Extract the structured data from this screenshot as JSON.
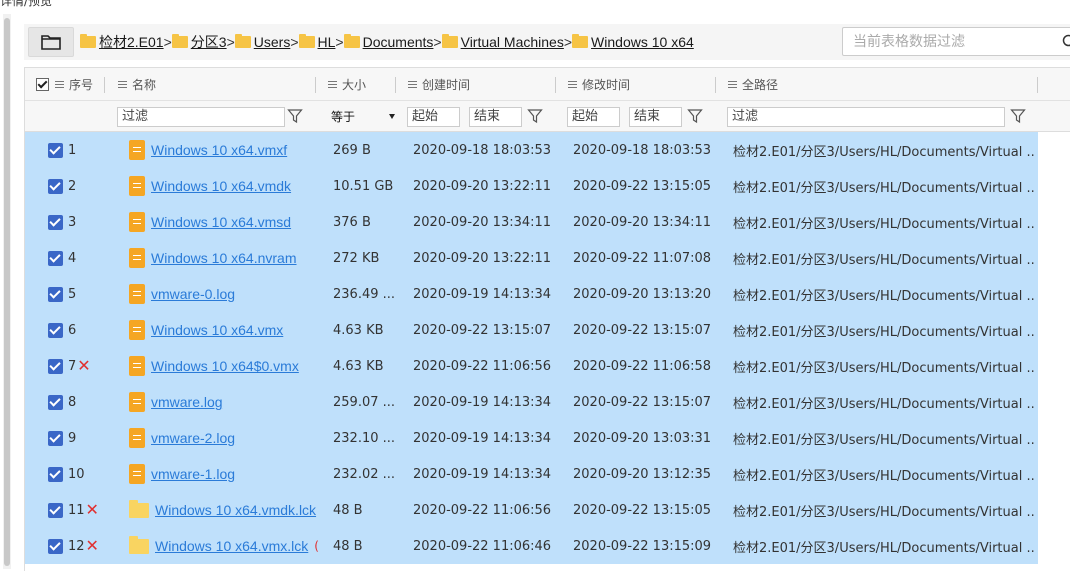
{
  "panel": {
    "title": "详情/预览"
  },
  "breadcrumb": {
    "items": [
      "检材2.E01",
      "分区3",
      "Users",
      "HL",
      "Documents",
      "Virtual Machines",
      "Windows 10 x64"
    ],
    "separator": ">"
  },
  "search": {
    "placeholder": "当前表格数据过滤"
  },
  "columns": {
    "index": "序号",
    "name": "名称",
    "size": "大小",
    "created": "创建时间",
    "modified": "修改时间",
    "path": "全路径"
  },
  "filters": {
    "name_placeholder": "过滤",
    "size_operator": "等于",
    "created_start": "起始",
    "created_end": "结束",
    "modified_start": "起始",
    "modified_end": "结束",
    "path_placeholder": "过滤"
  },
  "rows": [
    {
      "index": "1",
      "deleted": false,
      "icon": "document-icon",
      "name": "Windows 10 x64.vmxf",
      "size": "269 B",
      "created": "2020-09-18 18:03:53",
      "modified": "2020-09-18 18:03:53",
      "path": "检材2.E01/分区3/Users/HL/Documents/Virtual ..."
    },
    {
      "index": "2",
      "deleted": false,
      "icon": "document-icon",
      "name": "Windows 10 x64.vmdk",
      "size": "10.51 GB",
      "created": "2020-09-20 13:22:11",
      "modified": "2020-09-22 13:15:05",
      "path": "检材2.E01/分区3/Users/HL/Documents/Virtual ..."
    },
    {
      "index": "3",
      "deleted": false,
      "icon": "document-icon",
      "name": "Windows 10 x64.vmsd",
      "size": "376 B",
      "created": "2020-09-20 13:34:11",
      "modified": "2020-09-20 13:34:11",
      "path": "检材2.E01/分区3/Users/HL/Documents/Virtual ..."
    },
    {
      "index": "4",
      "deleted": false,
      "icon": "document-icon",
      "name": "Windows 10 x64.nvram",
      "size": "272 KB",
      "created": "2020-09-20 13:22:11",
      "modified": "2020-09-22 11:07:08",
      "path": "检材2.E01/分区3/Users/HL/Documents/Virtual ..."
    },
    {
      "index": "5",
      "deleted": false,
      "icon": "document-icon",
      "name": "vmware-0.log",
      "size": "236.49 ...",
      "created": "2020-09-19 14:13:34",
      "modified": "2020-09-20 13:13:20",
      "path": "检材2.E01/分区3/Users/HL/Documents/Virtual ..."
    },
    {
      "index": "6",
      "deleted": false,
      "icon": "document-icon",
      "name": "Windows 10 x64.vmx",
      "size": "4.63 KB",
      "created": "2020-09-22 13:15:07",
      "modified": "2020-09-22 13:15:07",
      "path": "检材2.E01/分区3/Users/HL/Documents/Virtual ..."
    },
    {
      "index": "7",
      "deleted": true,
      "icon": "document-icon",
      "name": "Windows 10 x64$0.vmx",
      "size": "4.63 KB",
      "created": "2020-09-22 11:06:56",
      "modified": "2020-09-22 11:06:58",
      "path": "检材2.E01/分区3/Users/HL/Documents/Virtual ..."
    },
    {
      "index": "8",
      "deleted": false,
      "icon": "document-icon",
      "name": "vmware.log",
      "size": "259.07 ...",
      "created": "2020-09-19 14:13:34",
      "modified": "2020-09-22 13:15:07",
      "path": "检材2.E01/分区3/Users/HL/Documents/Virtual ..."
    },
    {
      "index": "9",
      "deleted": false,
      "icon": "document-icon",
      "name": "vmware-2.log",
      "size": "232.10 ...",
      "created": "2020-09-19 14:13:34",
      "modified": "2020-09-20 13:03:31",
      "path": "检材2.E01/分区3/Users/HL/Documents/Virtual ..."
    },
    {
      "index": "10",
      "deleted": false,
      "icon": "document-icon",
      "name": "vmware-1.log",
      "size": "232.02 ...",
      "created": "2020-09-19 14:13:34",
      "modified": "2020-09-20 13:12:35",
      "path": "检材2.E01/分区3/Users/HL/Documents/Virtual ..."
    },
    {
      "index": "11",
      "deleted": true,
      "icon": "folder-icon",
      "name": "Windows 10 x64.vmdk.lck",
      "size": "48 B",
      "created": "2020-09-22 11:06:56",
      "modified": "2020-09-22 13:15:05",
      "path": "检材2.E01/分区3/Users/HL/Documents/Virtual ..."
    },
    {
      "index": "12",
      "deleted": true,
      "icon": "folder-icon",
      "name": "Windows 10 x64.vmx.lck",
      "tail": "(",
      "size": "48 B",
      "created": "2020-09-22 11:06:46",
      "modified": "2020-09-22 13:15:09",
      "path": "检材2.E01/分区3/Users/HL/Documents/Virtual ..."
    }
  ],
  "colors": {
    "row_selected": "#bfe0fb",
    "link": "#2a7bd8",
    "checkbox": "#3a67c7",
    "deleted_mark": "#e03030",
    "folder": "#f9d461",
    "file": "#f5a623"
  }
}
